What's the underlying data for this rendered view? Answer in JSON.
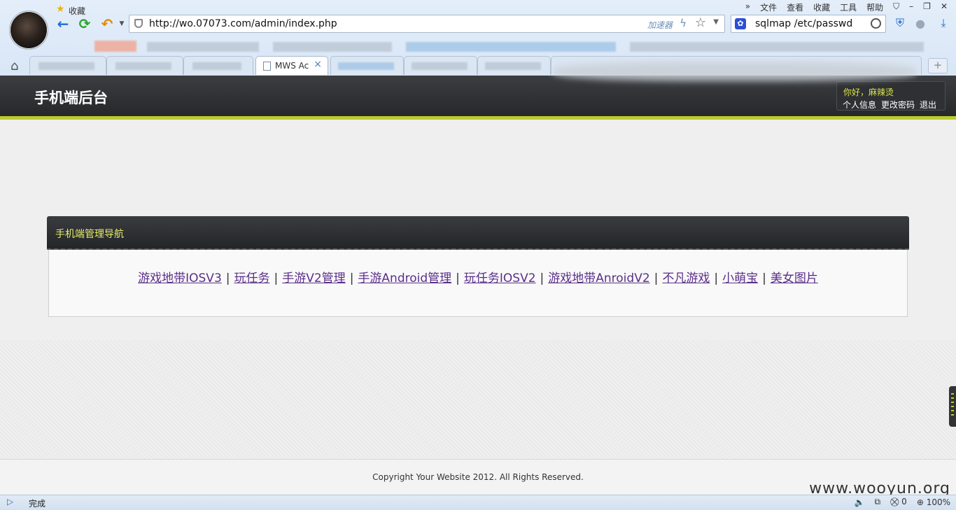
{
  "browser": {
    "menu": [
      "»",
      "文件",
      "查看",
      "收藏",
      "工具",
      "帮助"
    ],
    "address_url": "http://wo.07073.com/admin/index.php",
    "accelerator_label": "加速器",
    "search_query": "sqlmap /etc/passwd",
    "favorites_label": "收藏",
    "active_tab_label": "MWS Ac",
    "new_tab_symbol": "+"
  },
  "header": {
    "site_title": "手机端后台",
    "greeting": "你好，麻辣烫",
    "user_links": [
      "个人信息",
      "更改密码",
      "退出"
    ]
  },
  "panel": {
    "title": "手机端管理导航",
    "links": [
      "游戏地带IOSV3",
      "玩任务",
      "手游V2管理",
      "手游Android管理",
      "玩任务IOSV2",
      "游戏地带AnroidV2",
      "不凡游戏",
      "小萌宝",
      "美女图片"
    ],
    "separator": "|"
  },
  "footer": {
    "copyright": "Copyright Your Website 2012. All Rights Reserved."
  },
  "watermark": "www.wooyun.org",
  "status_bar": {
    "status": "完成",
    "security_count": "0",
    "zoom": "100%"
  }
}
